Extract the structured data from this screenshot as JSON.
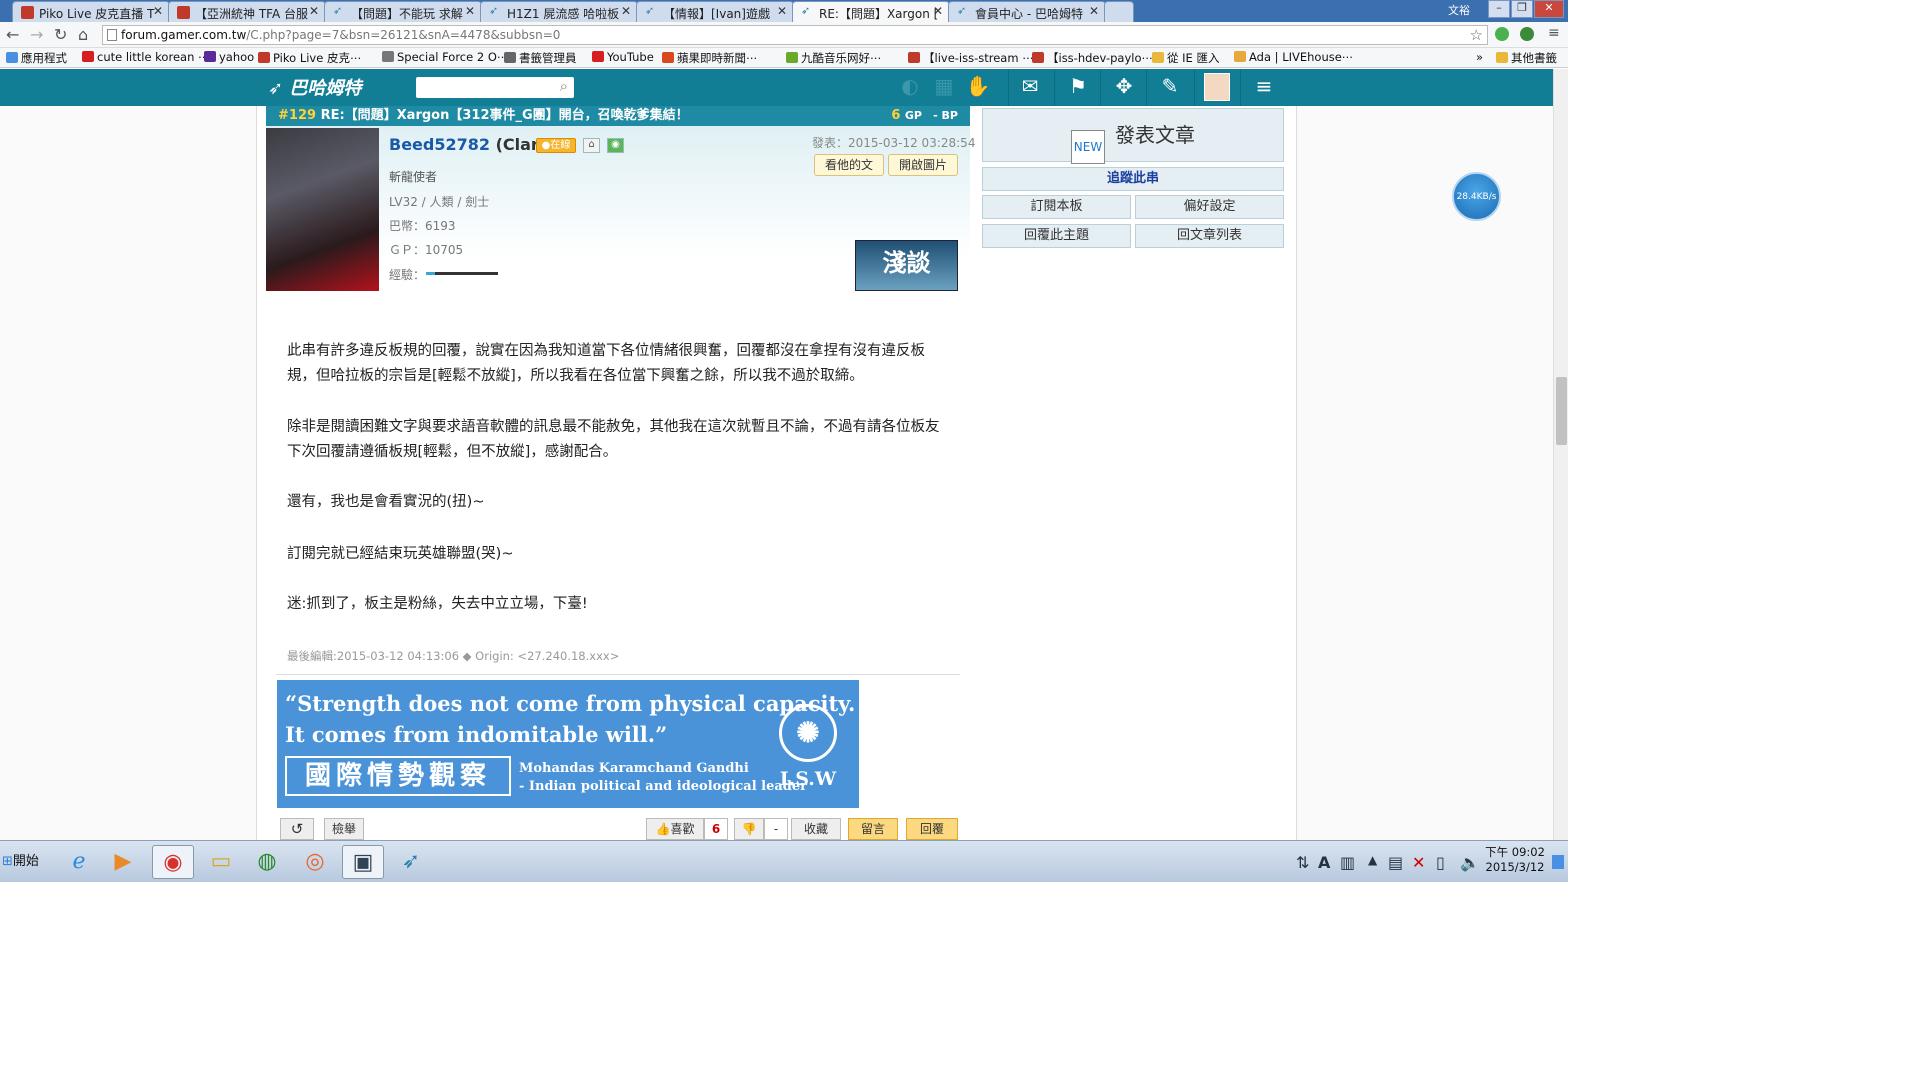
{
  "browser": {
    "tabs": [
      {
        "label": "Piko Live 皮克直播 T"
      },
      {
        "label": "【亞洲統神 TFA 台服"
      },
      {
        "label": "【問題】不能玩 求解"
      },
      {
        "label": "H1Z1 屍流感 哈啦板"
      },
      {
        "label": "【情報】[Ivan]遊戲"
      },
      {
        "label": "RE:【問題】Xargon ["
      },
      {
        "label": "會員中心 - 巴哈姆特"
      }
    ],
    "window_user": "文裕",
    "url_host": "forum.gamer.com.tw",
    "url_path": "/C.php?page=7&bsn=26121&snA=4478&subbsn=0",
    "bookmarks": [
      {
        "label": "應用程式",
        "color": "#4a90e2"
      },
      {
        "label": "cute little korean ⋯",
        "color": "#d81e1e"
      },
      {
        "label": "yahoo",
        "color": "#5a2a9a"
      },
      {
        "label": "Piko Live 皮克⋯",
        "color": "#c0392b"
      },
      {
        "label": "Special Force 2 O⋯",
        "color": "#777777"
      },
      {
        "label": "書籤管理員",
        "color": "#666666"
      },
      {
        "label": "YouTube",
        "color": "#d81e1e"
      },
      {
        "label": "蘋果即時新聞⋯",
        "color": "#d84a1e"
      },
      {
        "label": "九酷音乐网好⋯",
        "color": "#6aaa2a"
      },
      {
        "label": "【live-iss-stream ⋯",
        "color": "#c0392b"
      },
      {
        "label": "【iss-hdev-paylo⋯",
        "color": "#c0392b"
      },
      {
        "label": "從 IE 匯入",
        "color": "#e8b83a"
      },
      {
        "label": "Ada | LIVEhouse⋯",
        "color": "#e8a83a"
      }
    ],
    "other_bookmarks": "其他書籤"
  },
  "site": {
    "logo": "巴哈姆特"
  },
  "post": {
    "floor": "#129",
    "title": "RE:【問題】Xargon【312事件_G團】開台，召喚乾爹集結！",
    "gp_count": "6",
    "gp_label": "GP",
    "bp_label": "- BP",
    "user_id": "Beed52782",
    "user_nick": "(Clare)",
    "online_label": "●在線",
    "user_title": "斬龍使者",
    "user_level": "LV32 / 人類 / 劍士",
    "user_coins": "巴幣：6193",
    "user_gp": "ＧＰ：10705",
    "user_exp_label": "經驗：",
    "exp_progress": 0.12,
    "date": "發表：2015-03-12 03:28:54",
    "btn_his_posts": "看他的文",
    "btn_open_images": "開啟圖片",
    "badge_text": "淺談",
    "paragraphs": [
      "此串有許多違反板規的回覆，說實在因為我知道當下各位情緒很興奮，回覆都沒在拿捏有沒有違反板規，但哈拉板的宗旨是[輕鬆不放縱]，所以我看在各位當下興奮之餘，所以我不過於取締。",
      "除非是閱讀困難文字與要求語音軟體的訊息最不能赦免，其他我在這次就暫且不論，不過有請各位板友下次回覆請遵循板規[輕鬆，但不放縱]，感謝配合。",
      "還有，我也是會看實況的(扭)~",
      "訂閱完就已經結束玩英雄聯盟(哭)~",
      "迷:抓到了，板主是粉絲，失去中立立場，下臺!"
    ],
    "last_edit": "最後編輯:2015-03-12 04:13:06 ◆ Origin: <27.240.18.xxx>",
    "signature": {
      "quote_line1": "“Strength does not come from physical capacity.",
      "quote_line2": "It comes from indomitable will.”",
      "chinese": "國際情勢觀察",
      "author_line1": "Mohandas Karamchand Gandhi",
      "author_line2": "- Indian political and ideological leader",
      "org": "I.S.W"
    },
    "actions": {
      "report": "檢舉",
      "like": "喜歡",
      "like_count": "6",
      "dislike_count": "-",
      "favorite": "收藏",
      "comment": "留言",
      "reply": "回覆"
    }
  },
  "sidebar": {
    "post_article": "發表文章",
    "track_thread": "追蹤此串",
    "subscribe_board": "訂閱本板",
    "preferences": "偏好設定",
    "reply_topic": "回覆此主題",
    "back_to_list": "回文章列表"
  },
  "speed_widget": "28.4KB/s",
  "taskbar": {
    "start": "開始",
    "time": "下午 09:02",
    "date": "2015/3/12"
  }
}
